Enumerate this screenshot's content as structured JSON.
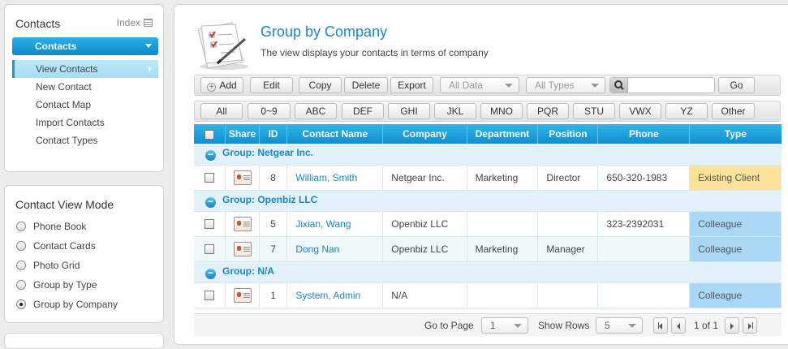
{
  "sidebar": {
    "contacts_title": "Contacts",
    "index_label": "Index",
    "section_header": "Contacts",
    "menu": [
      "View Contacts",
      "New Contact",
      "Contact Map",
      "Import Contacts",
      "Contact Types"
    ],
    "viewmode_title": "Contact View Mode",
    "viewmodes": [
      "Phone Book",
      "Contact Cards",
      "Photo Grid",
      "Group by Type",
      "Group by Company"
    ],
    "selected_viewmode": "Group by Company"
  },
  "header": {
    "title": "Group by Company",
    "description": "The view displays your contacts in terms of company"
  },
  "toolbar": {
    "add": "Add",
    "edit": "Edit",
    "copy": "Copy",
    "delete": "Delete",
    "export": "Export",
    "all_data": "All Data",
    "all_types": "All Types",
    "search_placeholder": "",
    "go": "Go"
  },
  "alpha": [
    "All",
    "0~9",
    "ABC",
    "DEF",
    "GHI",
    "JKL",
    "MNO",
    "PQR",
    "STU",
    "VWX",
    "YZ",
    "Other"
  ],
  "table": {
    "headers": [
      "Share",
      "ID",
      "Contact Name",
      "Company",
      "Department",
      "Position",
      "Phone",
      "Type"
    ],
    "groups": [
      {
        "label": "Group: Netgear Inc.",
        "rows": [
          {
            "id": "8",
            "name": "William, Smith",
            "company": "Netgear Inc.",
            "dept": "Marketing",
            "pos": "Director",
            "phone": "650-320-1983",
            "type": "Existing Client"
          }
        ]
      },
      {
        "label": "Group: Openbiz LLC",
        "rows": [
          {
            "id": "5",
            "name": "Jixian, Wang",
            "company": "Openbiz LLC",
            "dept": "",
            "pos": "",
            "phone": "323-2392031",
            "type": "Colleague"
          },
          {
            "id": "7",
            "name": "Dong Nan",
            "company": "Openbiz LLC",
            "dept": "Marketing",
            "pos": "Manager",
            "phone": "",
            "type": "Colleague"
          }
        ]
      },
      {
        "label": "Group: N/A",
        "rows": [
          {
            "id": "1",
            "name": "System, Admin",
            "company": "N/A",
            "dept": "",
            "pos": "",
            "phone": "",
            "type": "Colleague"
          }
        ]
      }
    ]
  },
  "pager": {
    "goto_label": "Go to Page",
    "page_value": "1",
    "rows_label": "Show Rows",
    "rows_value": "5",
    "page_info": "1 of 1"
  },
  "colors": {
    "accent": "#1a87c4",
    "header_blue": "#108fd0",
    "client": "#fde39a",
    "colleague": "#a9d8f6"
  }
}
